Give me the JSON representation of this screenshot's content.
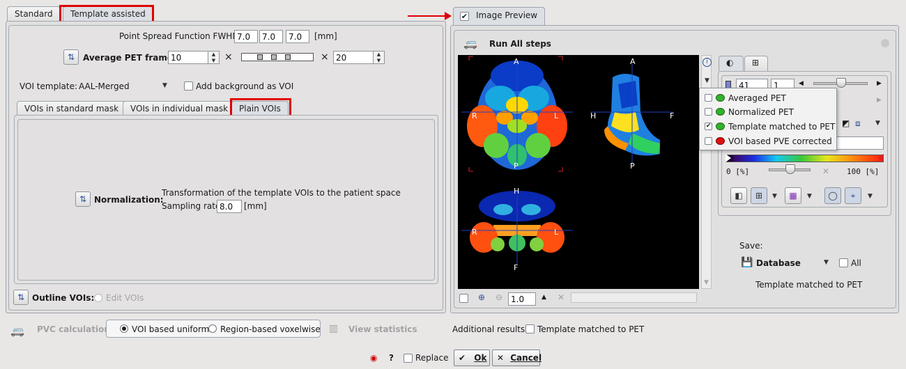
{
  "left_tabs": [
    "Standard",
    "Template assisted"
  ],
  "psf": {
    "label": "Point Spread Function FWHM",
    "x": "7.0",
    "y": "7.0",
    "z": "7.0",
    "unit": "[mm]"
  },
  "avg_frames": {
    "label": "Average PET frames",
    "start": "10",
    "end": "20",
    "times": "×"
  },
  "voi_template": {
    "label": "VOI template:",
    "value": "AAL-Merged",
    "add_bg_label": "Add background as VOI"
  },
  "sub_tabs": [
    "VOIs in standard mask",
    "VOIs in individual mask",
    "Plain VOIs"
  ],
  "normalization": {
    "label": "Normalization:",
    "description": "Transformation of the template VOIs to the patient space",
    "sampling_label": "Sampling rate",
    "sampling_value": "8.0",
    "sampling_unit": "[mm]"
  },
  "outline": {
    "label": "Outline VOIs:",
    "edit_label": "Edit VOIs"
  },
  "pvc": {
    "label": "PVC calculation",
    "option1": "VOI based uniform",
    "option2": "Region-based voxelwise",
    "view_stats": "View statistics"
  },
  "additional": {
    "label": "Additional results:",
    "checkbox_label": "Template matched to PET"
  },
  "bottom": {
    "help": "?",
    "replace": "Replace",
    "ok": "Ok",
    "cancel": "Cancel"
  },
  "preview": {
    "tab_label": "Image Preview",
    "run_all": "Run All steps",
    "zoom_value": "1.0",
    "axis": {
      "A": "A",
      "P": "P",
      "R": "R",
      "L": "L",
      "H": "H",
      "F": "F"
    },
    "slice_value": "41",
    "second_value": "1",
    "range_min": "0 [%]",
    "range_max": "100 [%]",
    "range_field": "0",
    "menu_items": [
      {
        "label": "Averaged PET",
        "checked": false,
        "color": "#2cb52c"
      },
      {
        "label": "Normalized PET",
        "checked": false,
        "color": "#2cb52c"
      },
      {
        "label": "Template matched to PET",
        "checked": true,
        "color": "#2cb52c"
      },
      {
        "label": "VOI based PVE corrected",
        "checked": false,
        "color": "#e01010"
      }
    ],
    "save_label": "Save:",
    "save_target": "Database",
    "save_all": "All",
    "status": "Template matched to PET"
  },
  "colors": {
    "highlight": "#e00000",
    "accent": "#2a4f9a"
  }
}
